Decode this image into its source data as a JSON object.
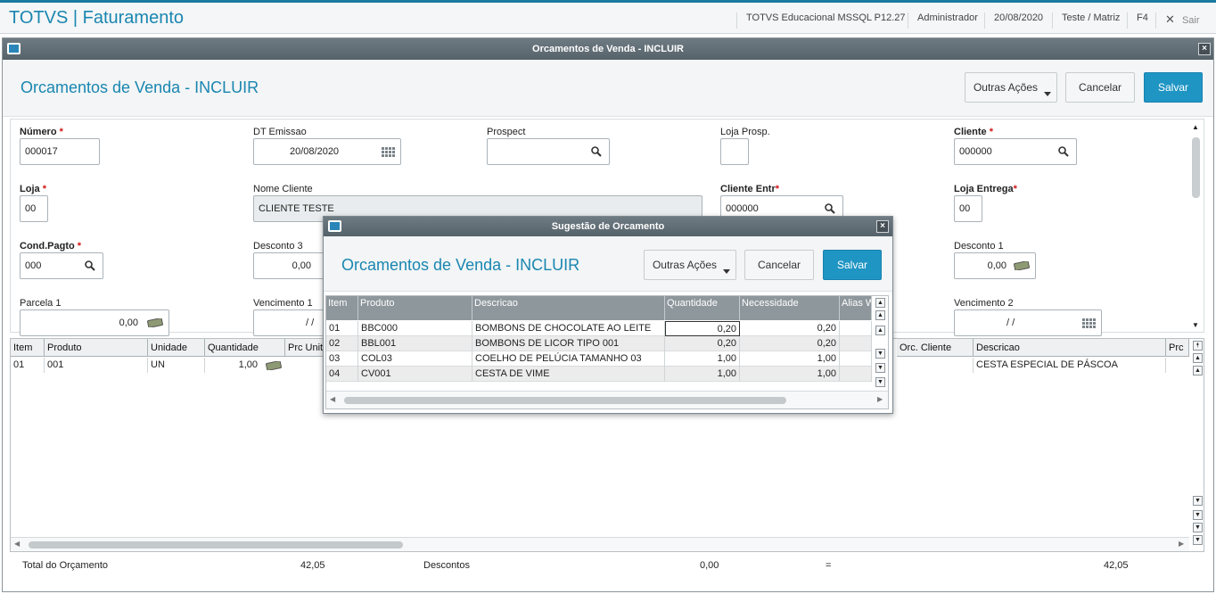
{
  "app_title": "TOTVS | Faturamento",
  "topbar": {
    "environment": "TOTVS Educacional MSSQL P12.27",
    "user": "Administrador",
    "date": "20/08/2020",
    "branch": "Teste / Matriz",
    "shortcut": "F4",
    "exit_label": "Sair"
  },
  "window": {
    "title": "Orcamentos de Venda - INCLUIR",
    "close": "×"
  },
  "header": {
    "title": "Orcamentos de Venda - INCLUIR",
    "more_actions": "Outras Ações",
    "cancel": "Cancelar",
    "save": "Salvar"
  },
  "form": {
    "numero": {
      "label": "Número",
      "value": "000017"
    },
    "dt_emissao": {
      "label": "DT Emissao",
      "value": "20/08/2020"
    },
    "prospect": {
      "label": "Prospect",
      "value": ""
    },
    "loja_prosp": {
      "label": "Loja Prosp.",
      "value": ""
    },
    "cliente": {
      "label": "Cliente",
      "value": "000000"
    },
    "loja": {
      "label": "Loja",
      "value": "00"
    },
    "nome_cliente": {
      "label": "Nome Cliente",
      "value": "CLIENTE TESTE"
    },
    "cliente_entr": {
      "label": "Cliente Entr",
      "value": "000000"
    },
    "loja_entrega": {
      "label": "Loja Entrega",
      "value": "00"
    },
    "cond_pagto": {
      "label": "Cond.Pagto",
      "value": "000"
    },
    "desconto3": {
      "label": "Desconto 3",
      "value": "0,00"
    },
    "desconto1": {
      "label": "Desconto 1",
      "value": "0,00"
    },
    "parcela1": {
      "label": "Parcela 1",
      "value": "0,00"
    },
    "vencimento1": {
      "label": "Vencimento 1",
      "value": "/ /"
    },
    "vencimento2": {
      "label": "Vencimento 2",
      "value": "/ /"
    },
    "required_mark": "*"
  },
  "items_grid": {
    "headers": {
      "item": "Item",
      "produto": "Produto",
      "unidade": "Unidade",
      "quantidade": "Quantidade",
      "prc_unit": "Prc Unita",
      "orc_cliente": "Orc. Cliente",
      "descricao": "Descricao",
      "prc": "Prc"
    },
    "row": {
      "item": "01",
      "produto": "001",
      "unidade": "UN",
      "quantidade": "1,00",
      "orc_cliente": "",
      "descricao": "CESTA ESPECIAL DE PÁSCOA"
    }
  },
  "totals": {
    "total_label": "Total do Orçamento",
    "total_value": "42,05",
    "desc_label": "Descontos",
    "desc_value": "0,00",
    "equals": "=",
    "final_value": "42,05"
  },
  "modal": {
    "title": "Sugestão de Orcamento",
    "close": "×",
    "header_title": "Orcamentos de Venda - INCLUIR",
    "more_actions": "Outras Ações",
    "cancel": "Cancelar",
    "save": "Salvar",
    "columns": {
      "item": "Item",
      "produto": "Produto",
      "descricao": "Descricao",
      "quantidade": "Quantidade",
      "necessidade": "Necessidade",
      "alias": "Alias W"
    },
    "rows": [
      {
        "item": "01",
        "produto": "BBC000",
        "descricao": "BOMBONS DE CHOCOLATE AO LEITE",
        "quantidade": "0,20",
        "necessidade": "0,20"
      },
      {
        "item": "02",
        "produto": "BBL001",
        "descricao": "BOMBONS DE LICOR TIPO 001",
        "quantidade": "0,20",
        "necessidade": "0,20"
      },
      {
        "item": "03",
        "produto": "COL03",
        "descricao": "COELHO DE PELÚCIA TAMANHO 03",
        "quantidade": "1,00",
        "necessidade": "1,00"
      },
      {
        "item": "04",
        "produto": "CV001",
        "descricao": "CESTA DE VIME",
        "quantidade": "1,00",
        "necessidade": "1,00"
      }
    ]
  },
  "colors": {
    "accent": "#1a86b0",
    "primary_button": "#1f95c4",
    "titlebar": "#5f6b73",
    "required": "#d01616"
  }
}
